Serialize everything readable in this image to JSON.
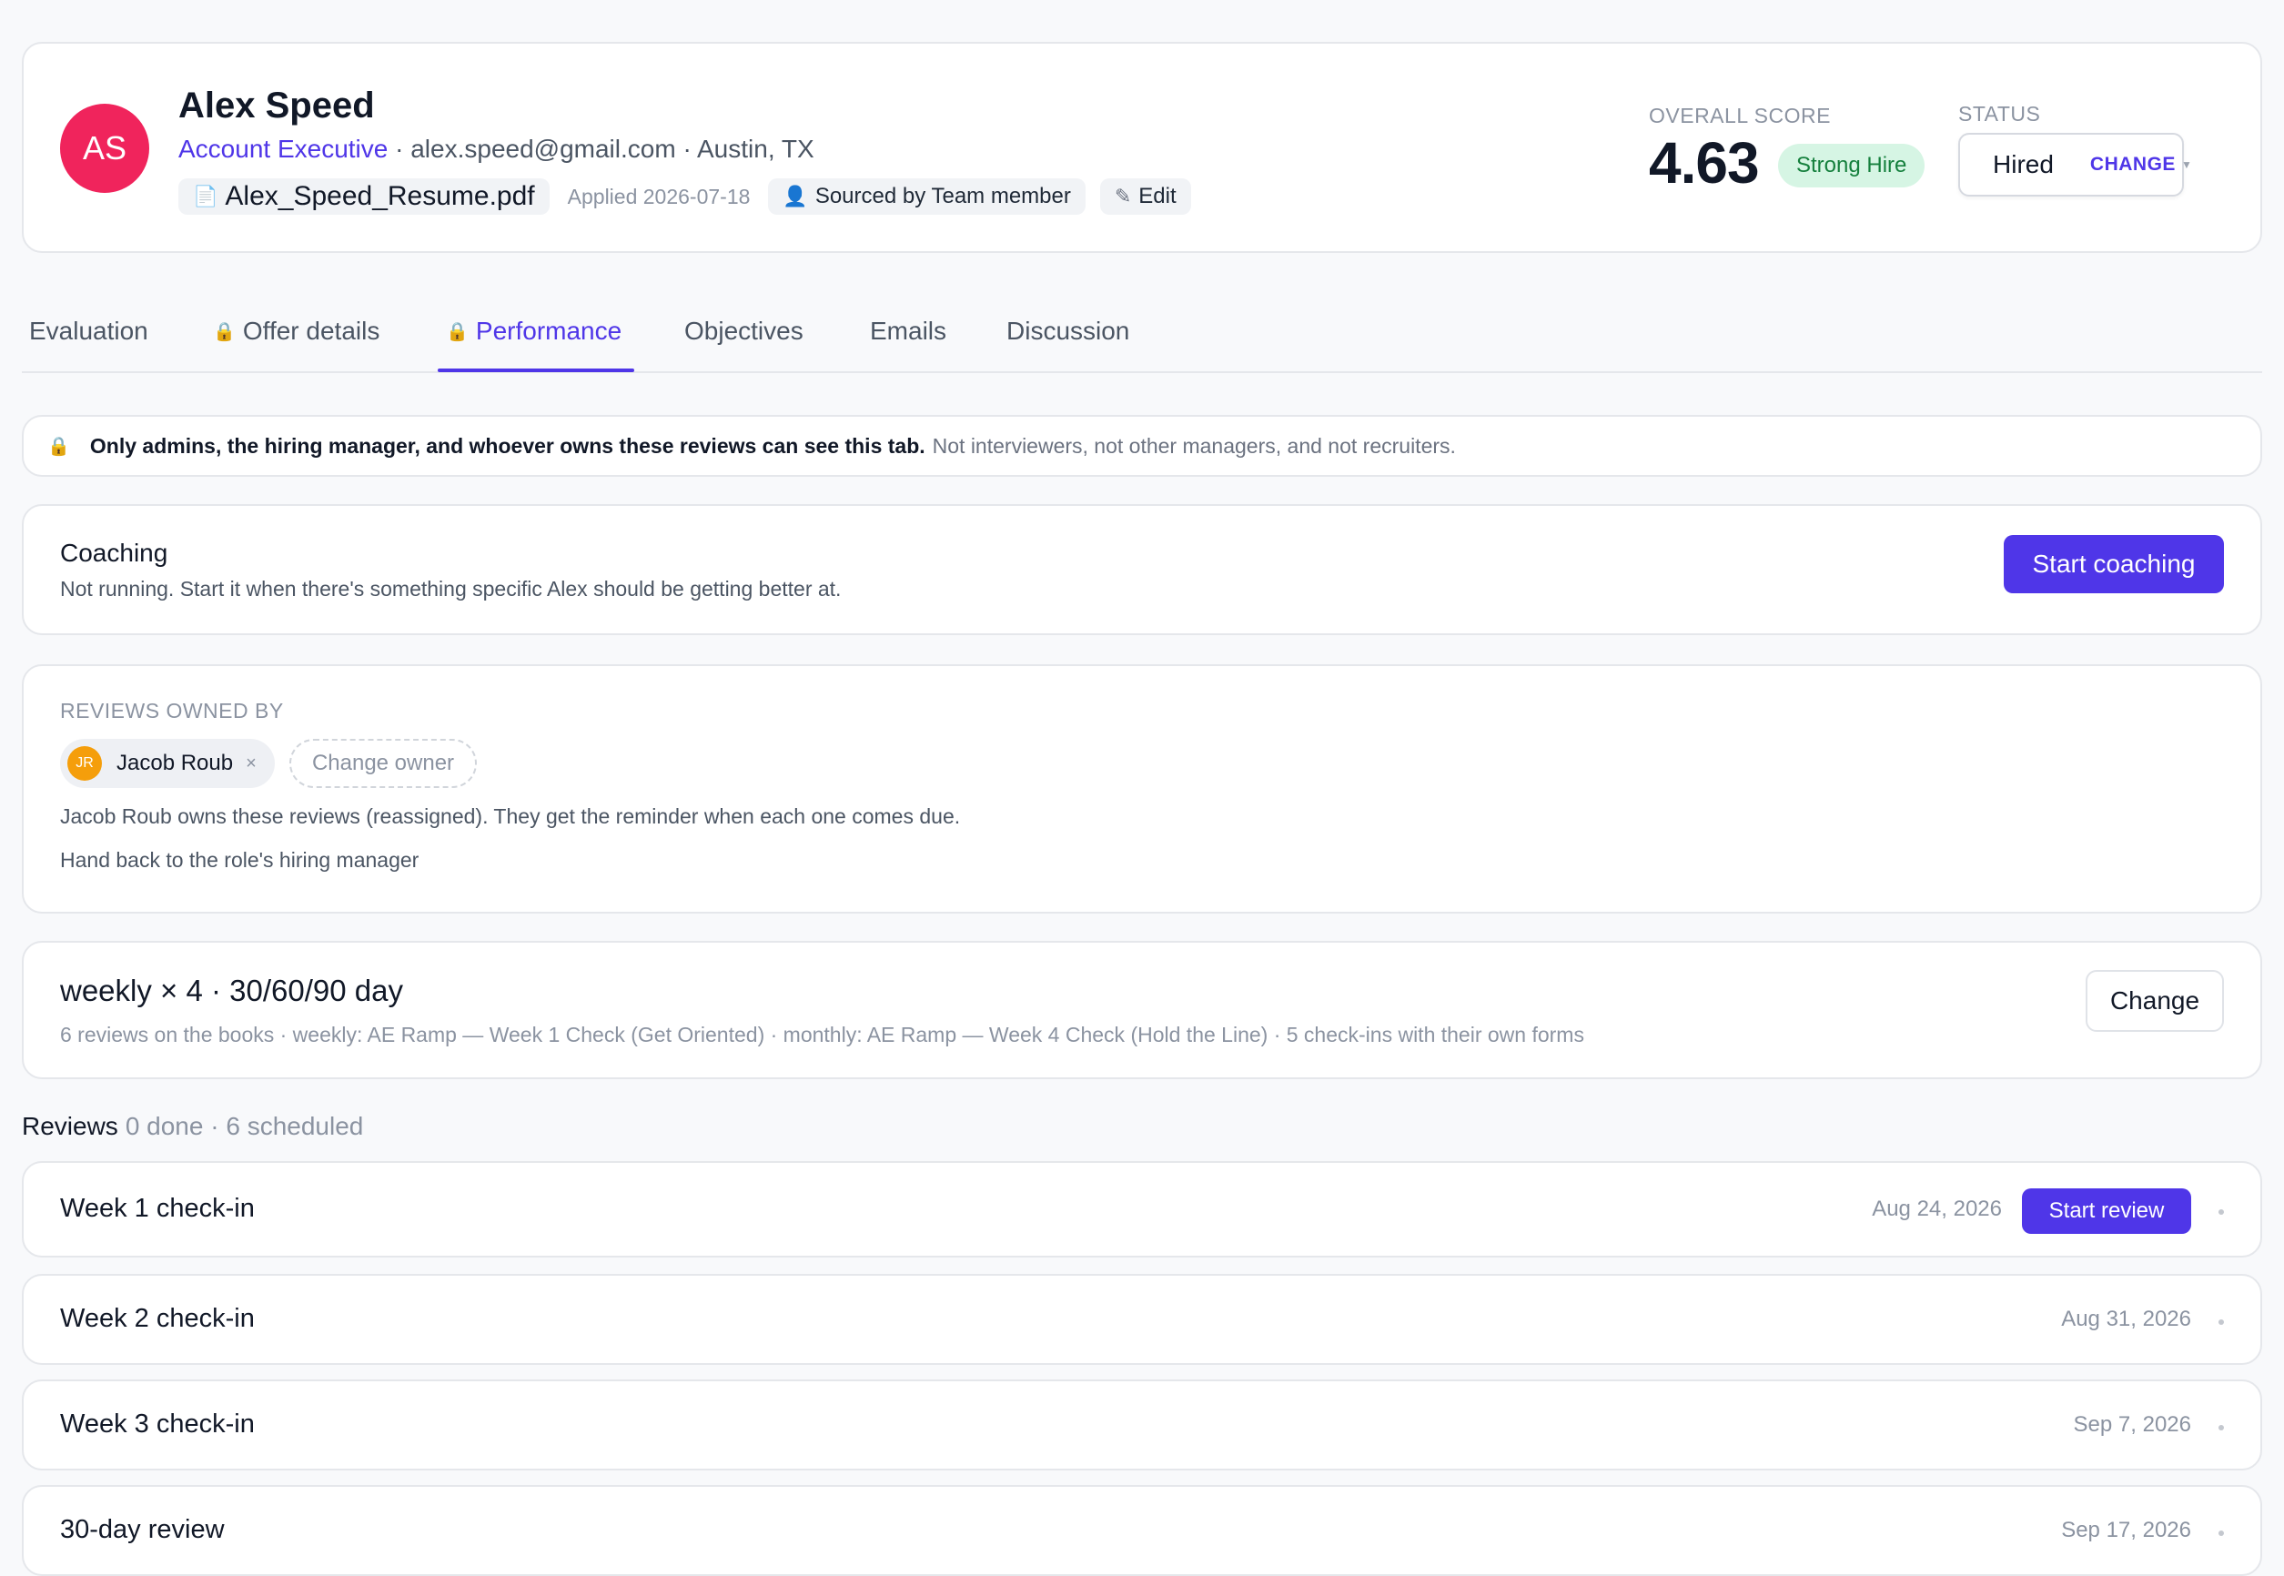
{
  "candidate": {
    "initials": "AS",
    "name": "Alex Speed",
    "role": "Account Executive",
    "contact": " · alex.speed@gmail.com · Austin, TX",
    "resume": "Alex_Speed_Resume.pdf",
    "applied": "Applied 2026-07-18",
    "sourced": "Sourced by Team member",
    "edit": "Edit"
  },
  "score": {
    "label": "OVERALL SCORE",
    "value": "4.63",
    "badge": "Strong Hire"
  },
  "status": {
    "label": "STATUS",
    "value": "Hired",
    "change": "CHANGE"
  },
  "tabs": [
    {
      "label": "Evaluation",
      "locked": false,
      "active": false
    },
    {
      "label": "Offer details",
      "locked": true,
      "active": false
    },
    {
      "label": "Performance",
      "locked": true,
      "active": true
    },
    {
      "label": "Objectives",
      "locked": false,
      "active": false
    },
    {
      "label": "Emails",
      "locked": false,
      "active": false
    },
    {
      "label": "Discussion",
      "locked": false,
      "active": false
    }
  ],
  "notice": {
    "bold": "Only admins, the hiring manager, and whoever owns these reviews can see this tab.",
    "muted": "Not interviewers, not other managers, and not recruiters."
  },
  "coaching": {
    "title": "Coaching",
    "subtitle": "Not running. Start it when there's something specific Alex should be getting better at.",
    "button": "Start coaching"
  },
  "owners": {
    "label": "REVIEWS OWNED BY",
    "owner_initials": "JR",
    "owner_name": "Jacob Roub",
    "remove": "×",
    "change_owner": "Change owner",
    "description": "Jacob Roub owns these reviews (reassigned). They get the reminder when each one comes due.",
    "handback": "Hand back to the role's hiring manager"
  },
  "cadence": {
    "title": "weekly × 4 · 30/60/90 day",
    "subtitle": "6 reviews on the books · weekly: AE Ramp — Week 1 Check (Get Oriented) · monthly: AE Ramp — Week 4 Check (Hold the Line) · 5 check-ins with their own forms",
    "button": "Change"
  },
  "reviews": {
    "label": "Reviews",
    "summary": "0 done · 6 scheduled",
    "items": [
      {
        "title": "Week 1 check-in",
        "date": "Aug 24, 2026",
        "action": "Start review"
      },
      {
        "title": "Week 2 check-in",
        "date": "Aug 31, 2026",
        "action": ""
      },
      {
        "title": "Week 3 check-in",
        "date": "Sep 7, 2026",
        "action": ""
      },
      {
        "title": "30-day review",
        "date": "Sep 17, 2026",
        "action": ""
      }
    ]
  },
  "colors": {
    "accent": "#4f36e8",
    "avatar": "#f0245c",
    "success": "#109260",
    "badge_bg": "#d6f5e4"
  },
  "icons": [
    "file-icon",
    "person-icon",
    "pencil-icon",
    "lock-icon",
    "status-dot-icon",
    "caret-down-icon",
    "remove-icon",
    "more-dot-icon"
  ]
}
